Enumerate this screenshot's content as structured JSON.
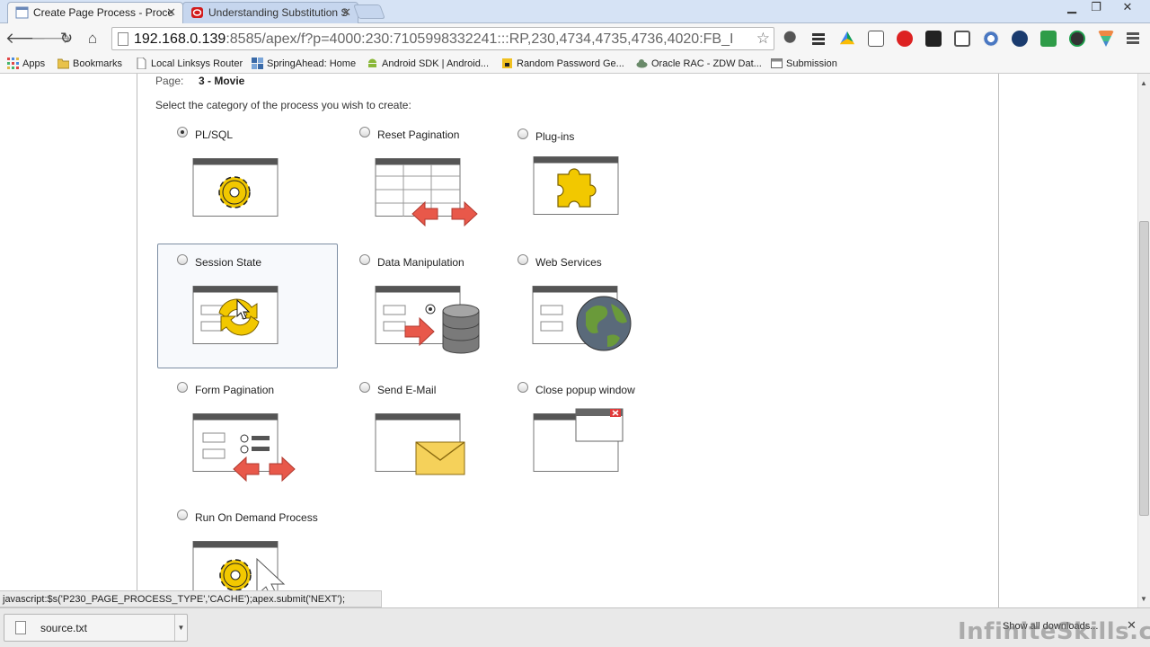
{
  "tabs": [
    {
      "label": "Create Page Process - Proce",
      "favicon": "page-icon",
      "active": true
    },
    {
      "label": "Understanding Substitution S",
      "favicon": "oracle-icon",
      "active": false
    }
  ],
  "toolbar": {
    "url_host": "192.168.0.139",
    "url_rest": ":8585/apex/f?p=4000:230:7105998332241:::RP,230,4734,4735,4736,4020:FB_I"
  },
  "bookmarks": [
    {
      "label": "Apps",
      "icon": "apps-grid-icon"
    },
    {
      "label": "Bookmarks",
      "icon": "folder-icon"
    },
    {
      "label": "Local Linksys Router",
      "icon": "page-icon"
    },
    {
      "label": "SpringAhead: Home",
      "icon": "grid-icon"
    },
    {
      "label": "Android SDK | Android...",
      "icon": "android-icon"
    },
    {
      "label": "Random Password Ge...",
      "icon": "lock-icon"
    },
    {
      "label": "Oracle RAC - ZDW Dat...",
      "icon": "cloud-icon"
    },
    {
      "label": "Submission",
      "icon": "window-icon"
    }
  ],
  "form": {
    "page_label": "Page:",
    "page_value": "3 - Movie",
    "instruction": "Select the category of the process you wish to create:",
    "options": [
      {
        "label": "PL/SQL",
        "checked": true,
        "icon": "gear-icon"
      },
      {
        "label": "Reset Pagination",
        "checked": false,
        "icon": "table-arrows-icon"
      },
      {
        "label": "Plug-ins",
        "checked": false,
        "icon": "puzzle-icon"
      },
      {
        "label": "Session State",
        "checked": false,
        "icon": "refresh-arrows-icon"
      },
      {
        "label": "Data Manipulation",
        "checked": false,
        "icon": "database-icon"
      },
      {
        "label": "Web Services",
        "checked": false,
        "icon": "globe-icon"
      },
      {
        "label": "Form Pagination",
        "checked": false,
        "icon": "form-arrows-icon"
      },
      {
        "label": "Send E-Mail",
        "checked": false,
        "icon": "envelope-icon"
      },
      {
        "label": "Close popup window",
        "checked": false,
        "icon": "close-popup-icon"
      },
      {
        "label": "Run On Demand Process",
        "checked": false,
        "icon": "gear-cursor-icon"
      }
    ]
  },
  "status_text": "javascript:$s('P230_PAGE_PROCESS_TYPE','CACHE');apex.submit('NEXT');",
  "downloads": {
    "file": "source.txt",
    "show_all": "Show all downloads..."
  },
  "watermark": "InfiniteSkills.com",
  "colors": {
    "tabstrip": "#d6e3f5",
    "toolbar": "#f6f6f6",
    "hover_border": "#7d8ea3",
    "gear": "#f2c800",
    "arrow": "#e8584a"
  }
}
